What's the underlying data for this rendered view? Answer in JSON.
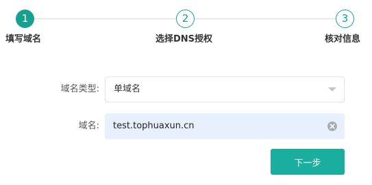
{
  "stepper": {
    "steps": [
      {
        "number": "1",
        "label": "填写域名",
        "state": "active"
      },
      {
        "number": "2",
        "label": "选择DNS授权",
        "state": "pending"
      },
      {
        "number": "3",
        "label": "核对信息",
        "state": "pending"
      }
    ],
    "accent_color": "#16a08f"
  },
  "form": {
    "domain_type": {
      "label": "域名类型:",
      "value": "单域名",
      "icon": "chevron-down-icon"
    },
    "domain": {
      "label": "域名:",
      "value": "test.tophuaxun.cn",
      "clear_icon": "clear-circle-icon",
      "autofill_color": "#e8f0fe"
    }
  },
  "actions": {
    "next_label": "下一步",
    "button_color": "#1aae9f"
  }
}
